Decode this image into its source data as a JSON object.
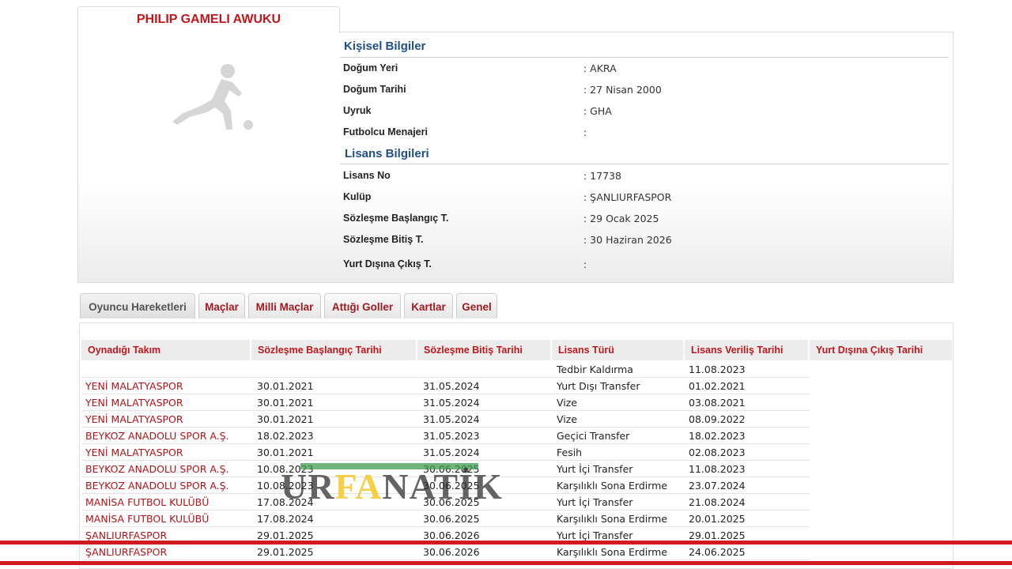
{
  "player": {
    "name": "PHILIP GAMELI AWUKU"
  },
  "personal": {
    "title": "Kişisel Bilgiler",
    "fields": [
      {
        "label": "Doğum Yeri",
        "value": ":  AKRA"
      },
      {
        "label": "Doğum Tarihi",
        "value": ":  27 Nisan 2000"
      },
      {
        "label": "Uyruk",
        "value": ":  GHA"
      },
      {
        "label": "Futbolcu Menajeri",
        "value": ":"
      }
    ]
  },
  "license": {
    "title": "Lisans Bilgileri",
    "fields": [
      {
        "label": "Lisans No",
        "value": ": 17738"
      },
      {
        "label": "Kulüp",
        "value": ": ŞANLIURFASPOR"
      },
      {
        "label": "Sözleşme Başlangıç T.",
        "value": ": 29 Ocak 2025"
      },
      {
        "label": "Sözleşme Bitiş T.",
        "value": ": 30 Haziran 2026"
      },
      {
        "label": "Yurt Dışına Çıkış T.",
        "value": ":"
      }
    ]
  },
  "tabs": [
    {
      "label": "Oyuncu Hareketleri",
      "active": true
    },
    {
      "label": "Maçlar"
    },
    {
      "label": "Milli Maçlar"
    },
    {
      "label": "Attığı Goller"
    },
    {
      "label": "Kartlar"
    },
    {
      "label": "Genel"
    }
  ],
  "table": {
    "headers": [
      "Oynadığı Takım",
      "Sözleşme Başlangıç Tarihi",
      "Sözleşme Bitiş Tarihi",
      "Lisans Türü",
      "Lisans Veriliş Tarihi",
      "Yurt Dışına Çıkış Tarihi"
    ],
    "rows": [
      {
        "team": "",
        "start": "",
        "end": "",
        "type": "Tedbir Kaldırma",
        "date": "11.08.2023"
      },
      {
        "team": "YENİ MALATYASPOR",
        "start": "30.01.2021",
        "end": "31.05.2024",
        "type": "Yurt Dışı Transfer",
        "date": "01.02.2021"
      },
      {
        "team": "YENİ MALATYASPOR",
        "start": "30.01.2021",
        "end": "31.05.2024",
        "type": "Vize",
        "date": "03.08.2021"
      },
      {
        "team": "YENİ MALATYASPOR",
        "start": "30.01.2021",
        "end": "31.05.2024",
        "type": "Vize",
        "date": "08.09.2022"
      },
      {
        "team": "BEYKOZ ANADOLU SPOR A.Ş.",
        "start": "18.02.2023",
        "end": "31.05.2023",
        "type": "Geçici Transfer",
        "date": "18.02.2023"
      },
      {
        "team": "YENİ MALATYASPOR",
        "start": "30.01.2021",
        "end": "31.05.2024",
        "type": "Fesih",
        "date": "02.08.2023"
      },
      {
        "team": "BEYKOZ ANADOLU SPOR A.Ş.",
        "start": "10.08.2023",
        "end": "30.06.2025",
        "type": "Yurt İçi Transfer",
        "date": "11.08.2023"
      },
      {
        "team": "BEYKOZ ANADOLU SPOR A.Ş.",
        "start": "10.08.2023",
        "end": "30.06.2025",
        "type": "Karşılıklı Sona Erdirme",
        "date": "23.07.2024"
      },
      {
        "team": "MANİSA FUTBOL KULÜBÜ",
        "start": "17.08.2024",
        "end": "30.06.2025",
        "type": "Yurt İçi Transfer",
        "date": "21.08.2024"
      },
      {
        "team": "MANİSA FUTBOL KULÜBÜ",
        "start": "17.08.2024",
        "end": "30.06.2025",
        "type": "Karşılıklı Sona Erdirme",
        "date": "20.01.2025"
      },
      {
        "team": "ŞANLIURFASPOR",
        "start": "29.01.2025",
        "end": "30.06.2026",
        "type": "Yurt İçi Transfer",
        "date": "29.01.2025"
      },
      {
        "team": "ŞANLIURFASPOR",
        "start": "29.01.2025",
        "end": "30.06.2026",
        "type": "Karşılıklı Sona Erdirme",
        "date": "24.06.2025"
      }
    ]
  },
  "watermark": {
    "part1": "UR",
    "part2": "FA",
    "part3": "NATİK"
  },
  "colors": {
    "accent_red": "#c0171c",
    "section_blue": "#1f4f8a",
    "watermark_green": "#3e9b4f",
    "watermark_yellow": "#f5c828"
  }
}
